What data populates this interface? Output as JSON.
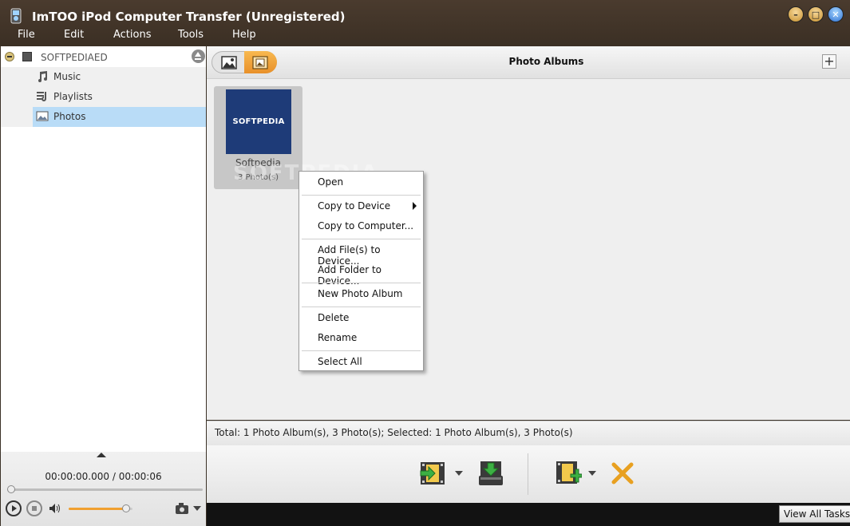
{
  "window": {
    "title": "ImTOO iPod Computer Transfer (Unregistered)"
  },
  "menu": {
    "file": "File",
    "edit": "Edit",
    "actions": "Actions",
    "tools": "Tools",
    "help": "Help"
  },
  "sidebar": {
    "device": "SOFTPEDIAED",
    "items": [
      {
        "label": "Music",
        "icon": "music-note-icon"
      },
      {
        "label": "Playlists",
        "icon": "playlist-icon"
      },
      {
        "label": "Photos",
        "icon": "photo-icon",
        "selected": true
      }
    ]
  },
  "header": {
    "title": "Photo Albums"
  },
  "album": {
    "thumb_text": "SOFTPEDIA",
    "name": "Softpedia",
    "count": "3 Photo(s)"
  },
  "watermark": "SOFTPEDIA",
  "context_menu": {
    "open": "Open",
    "copy_to_device": "Copy to Device",
    "copy_to_computer": "Copy to Computer...",
    "add_files": "Add File(s) to Device...",
    "add_folder": "Add Folder to Device...",
    "new_album": "New Photo Album",
    "delete": "Delete",
    "rename": "Rename",
    "select_all": "Select All"
  },
  "status": {
    "text": "Total: 1 Photo Album(s), 3 Photo(s); Selected: 1 Photo Album(s), 3 Photo(s)"
  },
  "player": {
    "time": "00:00:00.000 / 00:00:06",
    "progress": 0,
    "volume": 0.9
  },
  "taskbar": {
    "view_all_tasks": "View All Tasks"
  },
  "colors": {
    "titlebar": "#3b2f24",
    "selected": "#b9dcf7",
    "accent": "#f0a030",
    "thumb": "#1e3b78"
  }
}
